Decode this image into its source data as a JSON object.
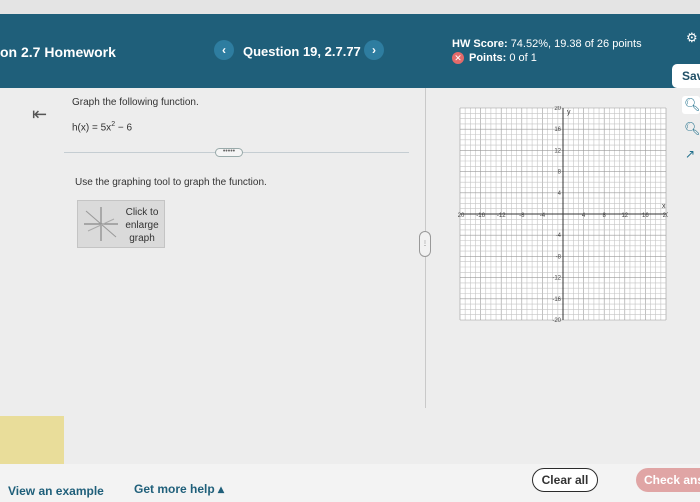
{
  "header": {
    "assignment_title": "on 2.7 Homework",
    "question_label": "Question 19, 2.7.77",
    "prev_glyph": "‹",
    "next_glyph": "›",
    "hw_score_label": "HW Score:",
    "hw_score_value": "74.52%, 19.38 of 26 points",
    "points_label": "Points:",
    "points_value": "0 of 1",
    "save_label": "Sav"
  },
  "question": {
    "instruction": "Graph the following function.",
    "function_prefix": "h(x) = 5x",
    "function_exponent": "2",
    "function_suffix": " − 6",
    "more_pill": "•••••",
    "tool_instruction": "Use the graphing tool to graph the function.",
    "enlarge_line1": "Click to",
    "enlarge_line2": "enlarge",
    "enlarge_line3": "graph"
  },
  "graph": {
    "x_axis_label": "x",
    "y_axis_label": "y",
    "x_range": [
      -20,
      20
    ],
    "y_range": [
      -20,
      20
    ],
    "minor_step": 1,
    "x_tick_labels": [
      -20,
      -16,
      -12,
      -8,
      -4,
      4,
      8,
      12,
      16,
      20
    ],
    "y_tick_labels": [
      20,
      16,
      12,
      8,
      4,
      -4,
      -8,
      -12,
      -16,
      -20
    ]
  },
  "footer": {
    "view_example": "View an example",
    "get_help": "Get more help",
    "get_help_caret": "▴",
    "clear_all": "Clear all",
    "check_answer": "Check ans"
  },
  "colors": {
    "header_bg": "#1f5f7a",
    "link": "#1f5f7a",
    "check_answer_bg": "#e0a5a5"
  }
}
